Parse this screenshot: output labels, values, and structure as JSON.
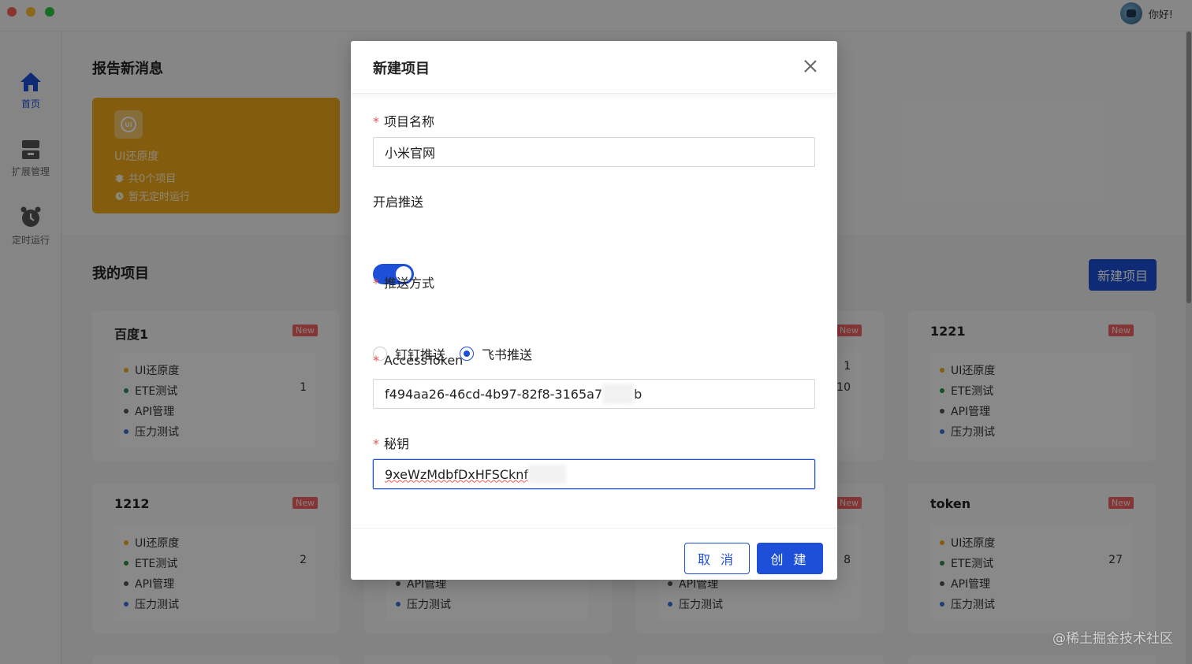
{
  "header": {
    "greeting": "你好!"
  },
  "sidebar": {
    "items": [
      {
        "label": "首页",
        "icon": "home-icon",
        "active": true
      },
      {
        "label": "扩展管理",
        "icon": "archive-icon",
        "active": false
      },
      {
        "label": "定时运行",
        "icon": "alarm-clock-icon",
        "active": false
      }
    ]
  },
  "report": {
    "section_title": "报告新消息",
    "card": {
      "badge": "UI",
      "title": "UI还原度",
      "projects": "共0个项目",
      "schedule": "暂无定时运行",
      "color": "#f0a81a"
    }
  },
  "projects": {
    "section_title": "我的项目",
    "new_button": "新建项目",
    "badge": "New",
    "item_labels": [
      "UI还原度",
      "ETE测试",
      "API管理",
      "压力测试"
    ],
    "item_colors": [
      "#f0a81a",
      "#2a8f4a",
      "#555555",
      "#3b6fd6"
    ],
    "cards": [
      {
        "name": "百度1",
        "count": "1"
      },
      {
        "name": "1221",
        "count": ""
      },
      {
        "name": "1212",
        "count": "2"
      },
      {
        "name": "token",
        "count": "27"
      }
    ],
    "partial_counts": {
      "row1_a": "1",
      "row1_b": "10",
      "row2": "8"
    }
  },
  "modal": {
    "title": "新建项目",
    "fields": {
      "name_label": "项目名称",
      "name_value": "小米官网",
      "push_label": "开启推送",
      "push_enabled": true,
      "method_label": "推送方式",
      "methods": [
        {
          "label": "钉钉推送",
          "checked": false
        },
        {
          "label": "飞书推送",
          "checked": true
        }
      ],
      "token_label": "AccessToken",
      "token_value_start": "f494aa26-46cd-4b97-82f8-3165a7",
      "token_value_end": "b",
      "secret_label": "秘钥",
      "secret_value": "9xeWzMdbfDxHFSCknf"
    },
    "cancel": "取 消",
    "create": "创 建"
  },
  "watermark": "@稀土掘金技术社区",
  "colors": {
    "primary": "#1d4fd8",
    "required": "#f25050",
    "new_badge": "#f06262"
  }
}
